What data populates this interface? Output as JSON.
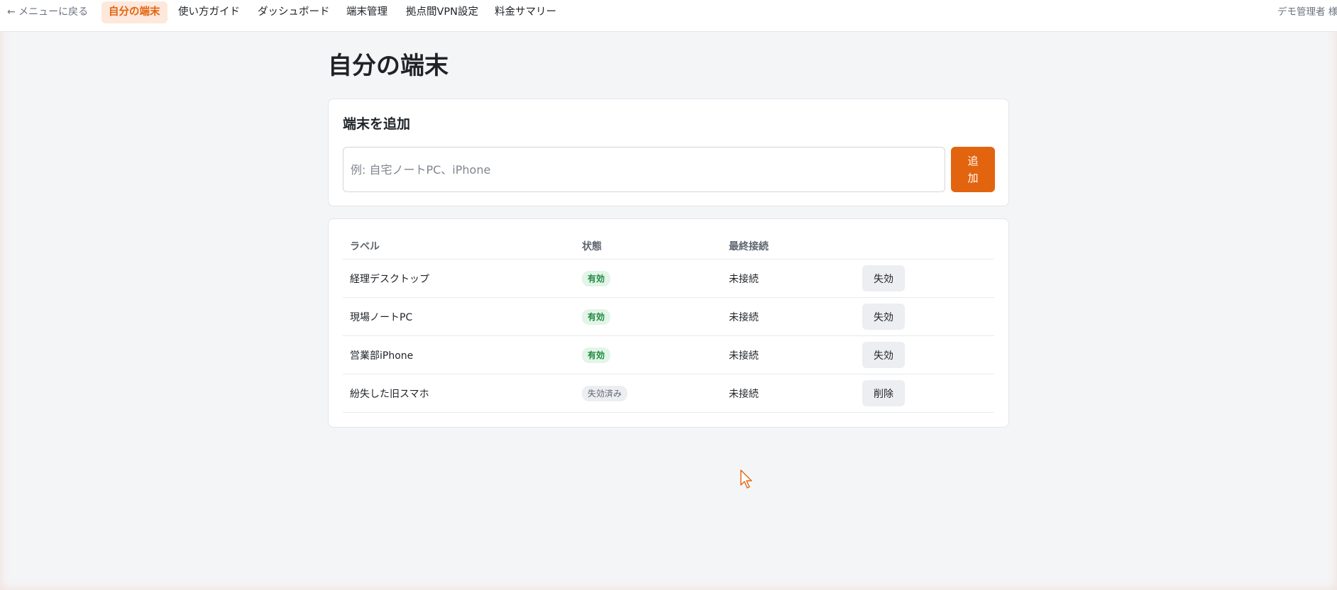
{
  "nav": {
    "back_label": "← メニューに戻る",
    "items": [
      {
        "label": "自分の端末",
        "active": true
      },
      {
        "label": "使い方ガイド",
        "active": false
      },
      {
        "label": "ダッシュボード",
        "active": false
      },
      {
        "label": "端末管理",
        "active": false
      },
      {
        "label": "拠点間VPN設定",
        "active": false
      },
      {
        "label": "料金サマリー",
        "active": false
      }
    ],
    "user_label": "デモ管理者 様"
  },
  "page": {
    "title": "自分の端末"
  },
  "add_card": {
    "heading": "端末を追加",
    "input_placeholder": "例: 自宅ノートPC、iPhone",
    "input_value": "",
    "add_button_label": "追加"
  },
  "device_table": {
    "columns": [
      "ラベル",
      "状態",
      "最終接続",
      ""
    ],
    "rows": [
      {
        "label": "経理デスクトップ",
        "status": "有効",
        "status_type": "active",
        "last_connection": "未接続",
        "action": "失効"
      },
      {
        "label": "現場ノートPC",
        "status": "有効",
        "status_type": "active",
        "last_connection": "未接続",
        "action": "失効"
      },
      {
        "label": "営業部iPhone",
        "status": "有効",
        "status_type": "active",
        "last_connection": "未接続",
        "action": "失効"
      },
      {
        "label": "紛失した旧スマホ",
        "status": "失効済み",
        "status_type": "revoked",
        "last_connection": "未接続",
        "action": "削除"
      }
    ]
  },
  "colors": {
    "accent": "#e3640f",
    "accent_soft": "#fde8db",
    "active_badge_text": "#1f8a3f",
    "active_badge_bg": "#e3f4e8",
    "page_bg": "#f4f5f7"
  },
  "icons": {
    "cursor": "mouse-pointer-icon"
  }
}
